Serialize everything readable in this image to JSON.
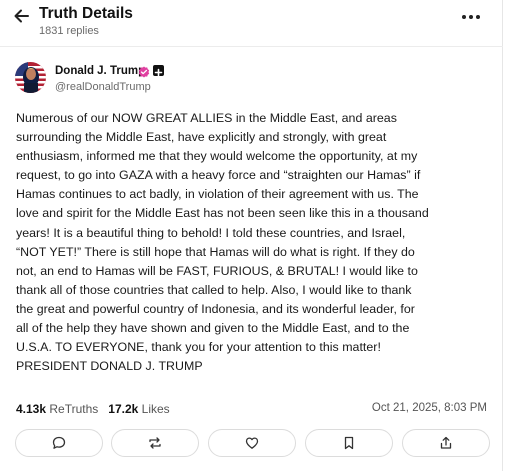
{
  "header": {
    "title": "Truth Details",
    "reply_count": "1831 replies",
    "back_icon": "arrow-left-icon",
    "more_icon": "more-dots-icon"
  },
  "author": {
    "name": "Donald J. Trump",
    "handle": "@realDonaldTrump",
    "verified_icon": "verified-badge-icon",
    "plus_icon": "plus-badge-icon",
    "verified_color": "#e040a0"
  },
  "post": {
    "text": "Numerous of our NOW GREAT ALLIES in the Middle East, and areas\nsurrounding the Middle East, have explicitly and strongly, with great\nenthusiasm, informed me that they would welcome the opportunity, at my\nrequest, to go into GAZA with a heavy force and “straighten our Hamas” if\nHamas continues to act badly, in violation of their agreement with us. The\nlove and spirit for the Middle East has not been seen like this in a thousand\nyears! It is a beautiful thing to behold! I told these countries, and Israel,\n“NOT YET!” There is still hope that Hamas will do what is right. If they do\nnot, an end to Hamas will be FAST, FURIOUS, & BRUTAL! I would like to\nthank all of those countries that called to help. Also, I would like to thank\nthe great and powerful country of Indonesia, and its wonderful leader, for\nall of the help they have shown and given to the Middle East, and to the\nU.S.A. TO EVERYONE, thank you for your attention to this matter!\nPRESIDENT DONALD J. TRUMP"
  },
  "stats": {
    "retruths_count": "4.13k",
    "retruths_label": "ReTruths",
    "likes_count": "17.2k",
    "likes_label": "Likes",
    "timestamp": "Oct 21, 2025, 8:03 PM"
  },
  "actions": [
    {
      "name": "reply",
      "icon": "comment-icon"
    },
    {
      "name": "retruth",
      "icon": "repost-icon"
    },
    {
      "name": "like",
      "icon": "heart-icon"
    },
    {
      "name": "bookmark",
      "icon": "bookmark-icon"
    },
    {
      "name": "share",
      "icon": "share-icon"
    }
  ]
}
